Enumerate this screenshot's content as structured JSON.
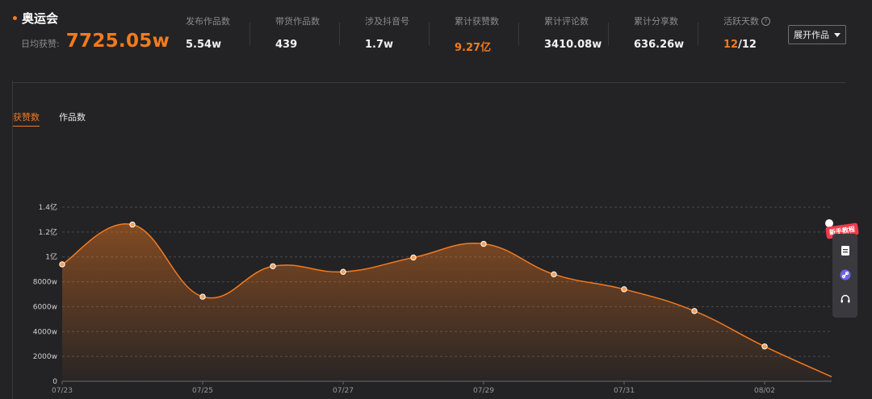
{
  "header": {
    "topic": "奥运会",
    "daily_label": "日均获赞:",
    "daily_value": "7725.05w"
  },
  "stats": [
    {
      "label": "发布作品数",
      "value": "5.54w"
    },
    {
      "label": "带货作品数",
      "value": "439"
    },
    {
      "label": "涉及抖音号",
      "value": "1.7w"
    },
    {
      "label": "累计获赞数",
      "value": "9.27亿",
      "highlight": true
    },
    {
      "label": "累计评论数",
      "value": "3410.08w"
    },
    {
      "label": "累计分享数",
      "value": "636.26w"
    },
    {
      "label": "活跃天数",
      "value_part1": "12",
      "value_part2": "/12"
    }
  ],
  "expand_button": "展开作品",
  "tabs": [
    {
      "label": "获赞数",
      "active": true
    },
    {
      "label": "作品数",
      "active": false
    }
  ],
  "sidebar": {
    "badge": "新手教程"
  },
  "colors": {
    "accent": "#f47a1f",
    "background": "#232325"
  },
  "chart_data": {
    "type": "area",
    "x": [
      "07/23",
      "07/24",
      "07/25",
      "07/26",
      "07/27",
      "07/28",
      "07/29",
      "07/30",
      "07/31",
      "08/01",
      "08/02",
      "08/03"
    ],
    "x_tick_labels": [
      "07/23",
      "07/25",
      "07/27",
      "07/29",
      "07/31",
      "08/02"
    ],
    "series": [
      {
        "values": [
          9400,
          12600,
          6800,
          9250,
          8800,
          9950,
          11050,
          8600,
          7400,
          5650,
          2800,
          250
        ]
      }
    ],
    "y_tick_values": [
      0,
      2000,
      4000,
      6000,
      8000,
      10000,
      12000,
      14000
    ],
    "y_tick_labels": [
      "0",
      "2000w",
      "4000w",
      "6000w",
      "8000w",
      "1亿",
      "1.2亿",
      "1.4亿"
    ],
    "ylim": [
      0,
      14000
    ],
    "y_unit": "w",
    "grid": true
  }
}
